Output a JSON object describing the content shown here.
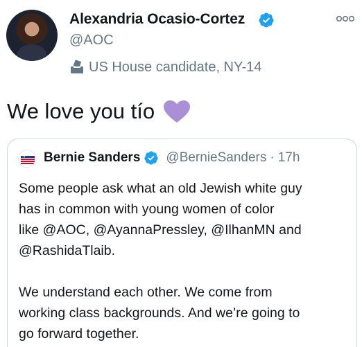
{
  "author": {
    "name": "Alexandria Ocasio-Cortez",
    "handle": "@AOC",
    "bio": "US House candidate, NY-14",
    "verified_color": "#1da1f2"
  },
  "tweet": {
    "text": "We love you tío",
    "emoji_icon": "purple-heart-icon",
    "emoji_color": "#aa8ed6"
  },
  "quoted_tweet": {
    "name": "Bernie Sanders",
    "handle": "@BernieSanders",
    "separator": "·",
    "time": "17h",
    "lines_p1": [
      "Some people ask what an old Jewish white guy",
      "has in common with young women of color",
      "like @AOC, @AyannaPressley, @IlhanMN and",
      "@RashidaTlaib."
    ],
    "lines_p2": [
      "We understand each other. We come from",
      "working class backgrounds. And we’re going to",
      "go forward together."
    ]
  }
}
